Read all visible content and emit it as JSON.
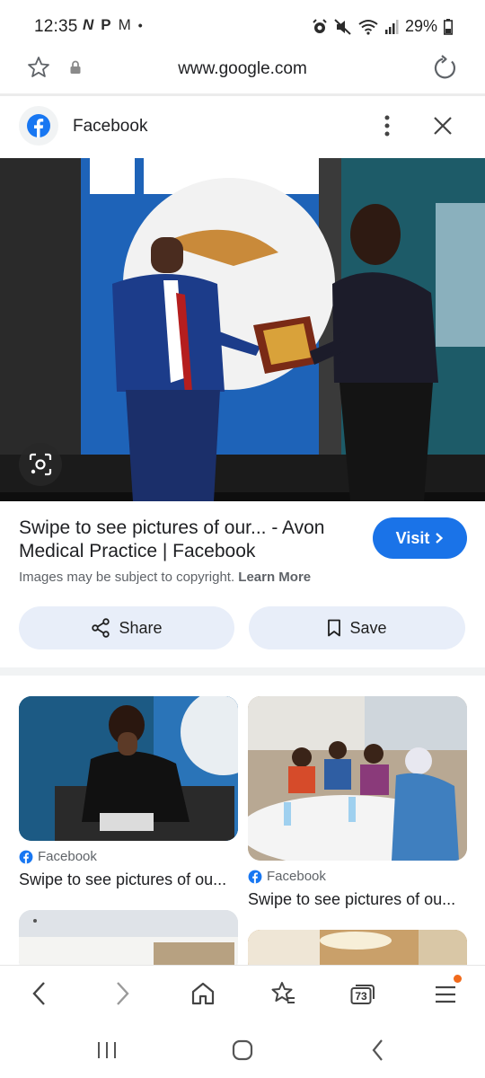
{
  "status": {
    "time": "12:35",
    "left_icons": [
      "N",
      "P",
      "M",
      "•"
    ],
    "battery": "29%"
  },
  "browser": {
    "url": "www.google.com"
  },
  "source": {
    "name": "Facebook"
  },
  "result": {
    "title": "Swipe to see pictures of our... - Avon Medical Practice | Facebook",
    "copyright": "Images may be subject to copyright.",
    "learn_more": "Learn More",
    "visit_label": "Visit",
    "share_label": "Share",
    "save_label": "Save"
  },
  "grid": [
    {
      "source": "Facebook",
      "caption": "Swipe to see pictures of ou..."
    },
    {
      "source": "Facebook",
      "caption": "Swipe to see pictures of ou..."
    }
  ],
  "toolbar": {
    "tab_count": "73"
  },
  "colors": {
    "accent": "#1a73e8",
    "chip_bg": "#e8eef9",
    "facebook_blue": "#1877f2",
    "notification_dot": "#f16a1b"
  }
}
